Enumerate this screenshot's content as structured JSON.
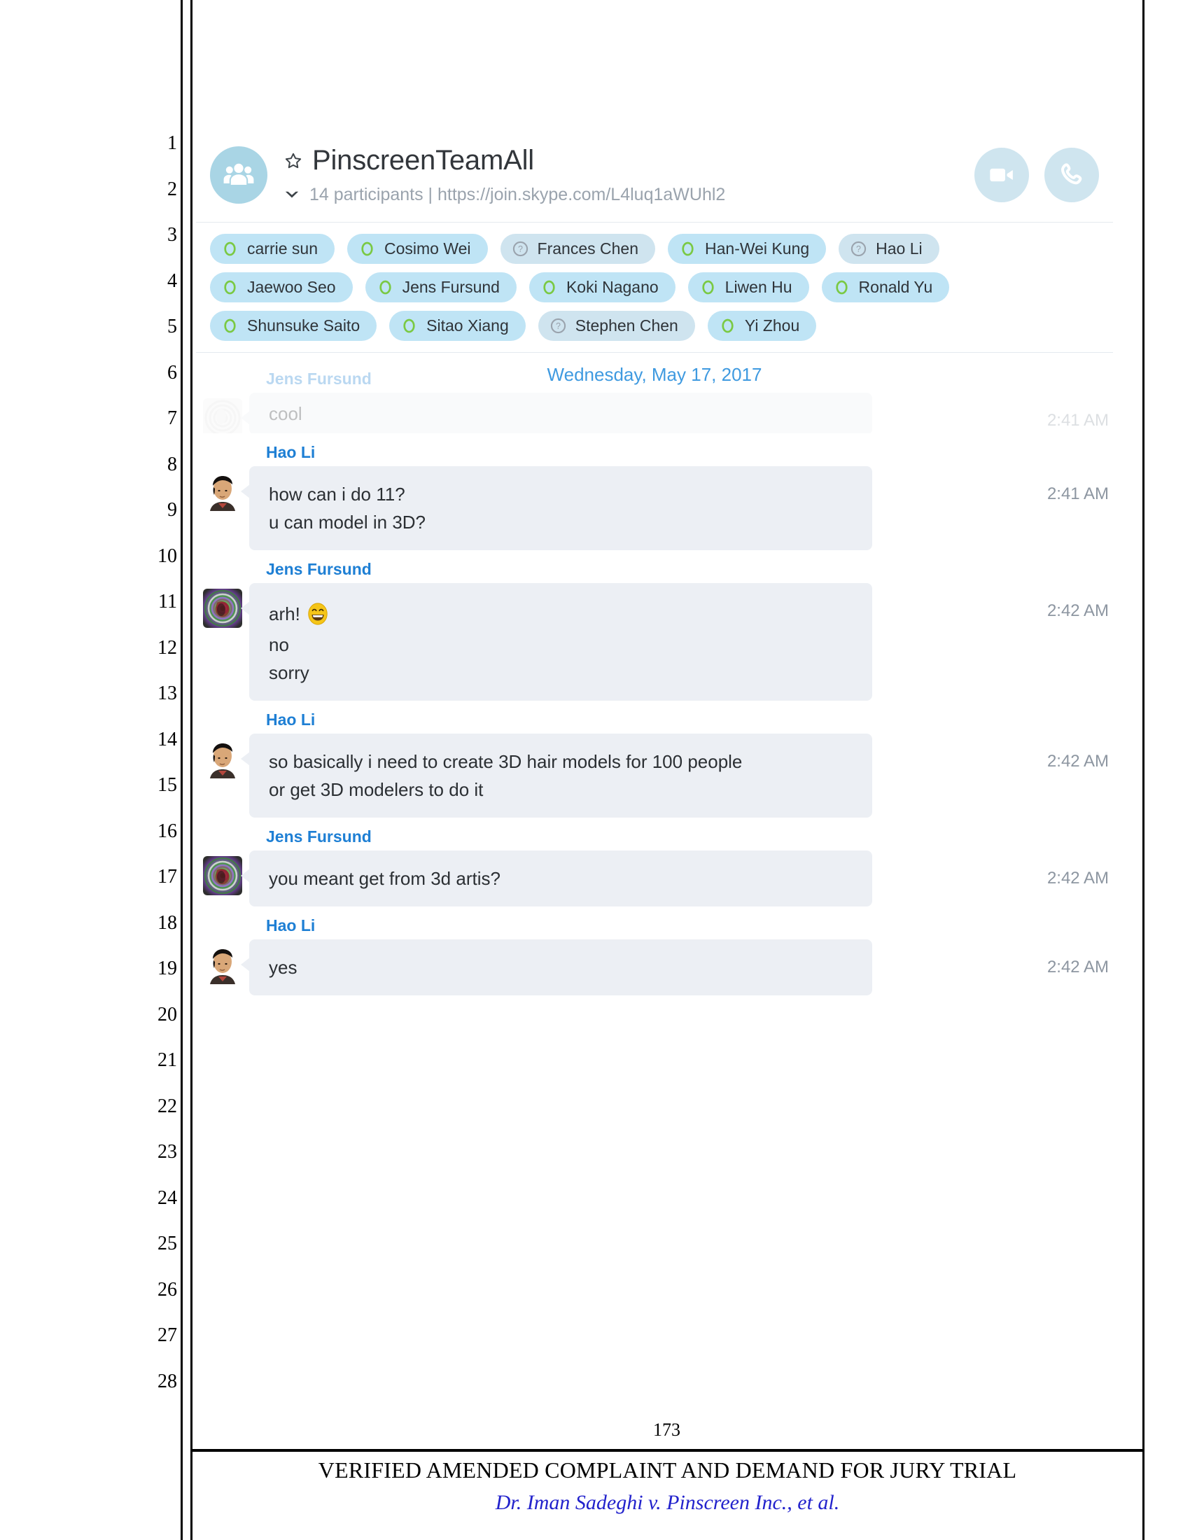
{
  "document": {
    "line_numbers": [
      "1",
      "2",
      "3",
      "4",
      "5",
      "6",
      "7",
      "8",
      "9",
      "10",
      "11",
      "12",
      "13",
      "14",
      "15",
      "16",
      "17",
      "18",
      "19",
      "20",
      "21",
      "22",
      "23",
      "24",
      "25",
      "26",
      "27",
      "28"
    ],
    "page_number": "173",
    "footer_title": "VERIFIED AMENDED COMPLAINT AND DEMAND FOR JURY TRIAL",
    "footer_case": "Dr. Iman Sadeghi v. Pinscreen Inc., et al.",
    "footer_case_color": "#2222cc"
  },
  "chat": {
    "header": {
      "group_avatar_icon": "people-group-icon",
      "favorite_icon": "star-icon",
      "title": "PinscreenTeamAll",
      "expand_icon": "chevron-down-icon",
      "participants_count_label": "14 participants",
      "separator": "|",
      "join_url": "https://join.skype.com/L4luq1aWUhl2",
      "subtitle": "14 participants  |  https://join.skype.com/L4luq1aWUhl2",
      "video_call_button": "video-call-icon",
      "audio_call_button": "phone-call-icon",
      "accent_color": "#a9d5e5"
    },
    "participants": {
      "rows": [
        [
          {
            "name": "carrie sun",
            "status": "online"
          },
          {
            "name": "Cosimo Wei",
            "status": "online"
          },
          {
            "name": "Frances Chen",
            "status": "unknown"
          },
          {
            "name": "Han-Wei Kung",
            "status": "online"
          },
          {
            "name": "Hao Li",
            "status": "unknown"
          }
        ],
        [
          {
            "name": "Jaewoo Seo",
            "status": "online"
          },
          {
            "name": "Jens Fursund",
            "status": "online"
          },
          {
            "name": "Koki Nagano",
            "status": "online"
          },
          {
            "name": "Liwen Hu",
            "status": "online"
          },
          {
            "name": "Ronald Yu",
            "status": "online"
          }
        ],
        [
          {
            "name": "Shunsuke Saito",
            "status": "online"
          },
          {
            "name": "Sitao Xiang",
            "status": "online"
          },
          {
            "name": "Stephen Chen",
            "status": "unknown"
          },
          {
            "name": "Yi Zhou",
            "status": "online"
          }
        ]
      ],
      "chip_bg_online": "#bfe4f5",
      "chip_bg_unknown": "#cfe4ef",
      "status_online_color": "#7ac943",
      "status_unknown_color": "#9aa3ad"
    },
    "date_divider": "Wednesday, May 17, 2017",
    "scrolled_message": {
      "sender": "Jens Fursund",
      "text": "cool",
      "time": "2:41 AM",
      "avatar": "spiral-avatar"
    },
    "messages": [
      {
        "sender": "Hao Li",
        "avatar": "hao-li-avatar",
        "time": "2:41 AM",
        "lines": [
          {
            "text": "how can i do 11?"
          },
          {
            "text": "u can model in 3D?"
          }
        ]
      },
      {
        "sender": "Jens Fursund",
        "avatar": "spiral-avatar",
        "time": "2:42 AM",
        "lines": [
          {
            "text": "arh!",
            "emoji": "grinning-face-emoji"
          },
          {
            "text": "no"
          },
          {
            "text": "sorry"
          }
        ]
      },
      {
        "sender": "Hao Li",
        "avatar": "hao-li-avatar",
        "time": "2:42 AM",
        "lines": [
          {
            "text": "so basically i need to create 3D hair models for 100 people"
          },
          {
            "text": "or get 3D modelers to do it"
          }
        ]
      },
      {
        "sender": "Jens Fursund",
        "avatar": "spiral-avatar",
        "time": "2:42 AM",
        "lines": [
          {
            "text": "you meant get from 3d artis?"
          }
        ]
      },
      {
        "sender": "Hao Li",
        "avatar": "hao-li-avatar",
        "time": "2:42 AM",
        "lines": [
          {
            "text": "yes"
          }
        ]
      }
    ],
    "colors": {
      "bubble_bg": "#eceff4",
      "sender_name": "#1e7fd4",
      "date_divider": "#3f9ae0",
      "timestamp": "#8d96a1",
      "title": "#32363b",
      "subtitle": "#9aa3ad"
    }
  }
}
